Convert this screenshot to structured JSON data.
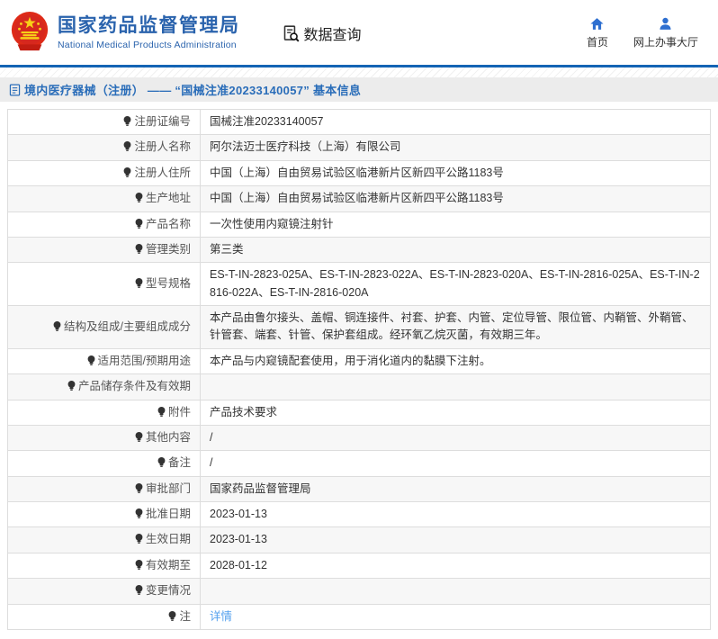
{
  "header": {
    "title": "国家药品监督管理局",
    "subtitle": "National Medical Products Administration",
    "data_query_label": "数据查询",
    "nav": [
      {
        "label": "首页",
        "icon": "home-icon"
      },
      {
        "label": "网上办事大厅",
        "icon": "person-icon"
      }
    ]
  },
  "breadcrumb": {
    "text": "境内医疗器械（注册） ——  “国械注准20233140057”  基本信息"
  },
  "table": {
    "rows": [
      {
        "label": "注册证编号",
        "value": "国械注准20233140057"
      },
      {
        "label": "注册人名称",
        "value": "阿尔法迈士医疗科技（上海）有限公司"
      },
      {
        "label": "注册人住所",
        "value": "中国（上海）自由贸易试验区临港新片区新四平公路1183号"
      },
      {
        "label": "生产地址",
        "value": "中国（上海）自由贸易试验区临港新片区新四平公路1183号"
      },
      {
        "label": "产品名称",
        "value": "一次性使用内窥镜注射针"
      },
      {
        "label": "管理类别",
        "value": "第三类"
      },
      {
        "label": "型号规格",
        "value": "ES-T-IN-2823-025A、ES-T-IN-2823-022A、ES-T-IN-2823-020A、ES-T-IN-2816-025A、ES-T-IN-2816-022A、ES-T-IN-2816-020A"
      },
      {
        "label": "结构及组成/主要组成成分",
        "value": "本产品由鲁尔接头、盖帽、铜连接件、衬套、护套、内管、定位导管、限位管、内鞘管、外鞘管、针管套、端套、针管、保护套组成。经环氧乙烷灭菌，有效期三年。"
      },
      {
        "label": "适用范围/预期用途",
        "value": "本产品与内窥镜配套使用，用于消化道内的黏膜下注射。"
      },
      {
        "label": "产品储存条件及有效期",
        "value": ""
      },
      {
        "label": "附件",
        "value": "产品技术要求"
      },
      {
        "label": "其他内容",
        "value": "/"
      },
      {
        "label": "备注",
        "value": "/"
      },
      {
        "label": "审批部门",
        "value": "国家药品监督管理局"
      },
      {
        "label": "批准日期",
        "value": "2023-01-13"
      },
      {
        "label": "生效日期",
        "value": "2023-01-13"
      },
      {
        "label": "有效期至",
        "value": "2028-01-12"
      },
      {
        "label": "变更情况",
        "value": ""
      },
      {
        "label": "注",
        "value": "详情",
        "link": true,
        "label_icon": "note-icon"
      }
    ]
  },
  "colors": {
    "accent_blue": "#1464b4",
    "title_blue": "#2a63ad",
    "nav_icon_blue": "#2e6fd0",
    "breadcrumb_blue": "#2a6db9",
    "link_blue": "#53a0ee",
    "breadcrumb_bg": "#ececec",
    "row_alt_bg": "#f7f7f7",
    "border": "#dddddd",
    "emblem_red": "#de2a18",
    "emblem_yellow": "#f7d117"
  }
}
